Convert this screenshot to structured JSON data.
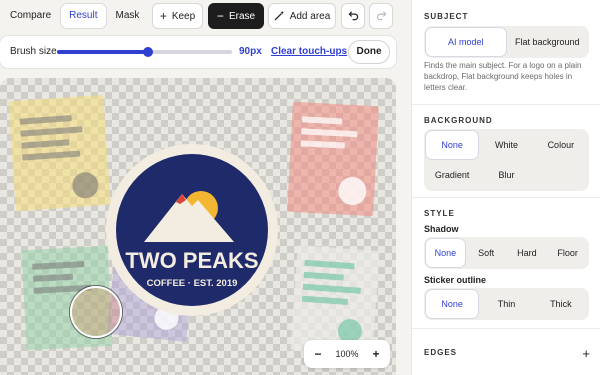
{
  "toolbar": {
    "view_modes": [
      "Compare",
      "Result",
      "Mask"
    ],
    "keep": "Keep",
    "erase": "Erase",
    "add_area": "Add area"
  },
  "brush": {
    "label": "Brush size",
    "value_text": "90px",
    "level": 0.52,
    "clear": "Clear touch-ups",
    "done": "Done"
  },
  "canvas": {
    "logo_title": "TWO PEAKS",
    "logo_subtitle": "COFFEE · EST. 2019"
  },
  "zoom": {
    "minus": "−",
    "level": "100%",
    "plus": "+"
  },
  "panel": {
    "subject": {
      "title": "SUBJECT",
      "options": [
        "AI model",
        "Flat background"
      ],
      "note": "Finds the main subject. For a logo on a plain backdrop, Flat background keeps holes in letters clear."
    },
    "background": {
      "title": "BACKGROUND",
      "options": [
        "None",
        "White",
        "Colour",
        "Gradient",
        "Blur"
      ]
    },
    "style": {
      "title": "STYLE",
      "shadow_label": "Shadow",
      "shadow_options": [
        "None",
        "Soft",
        "Hard",
        "Floor"
      ],
      "outline_label": "Sticker outline",
      "outline_options": [
        "None",
        "Thin",
        "Thick"
      ]
    },
    "edges": {
      "title": "EDGES",
      "expand": "+"
    }
  },
  "colors": {
    "accent": "#2f3fd1",
    "logo_navy": "#1f2a6b",
    "logo_cream": "#f3ece0",
    "sun": "#f2b632"
  },
  "icons": [
    "plus-icon",
    "erase-icon",
    "magic-wand-icon",
    "undo-icon",
    "redo-icon"
  ]
}
